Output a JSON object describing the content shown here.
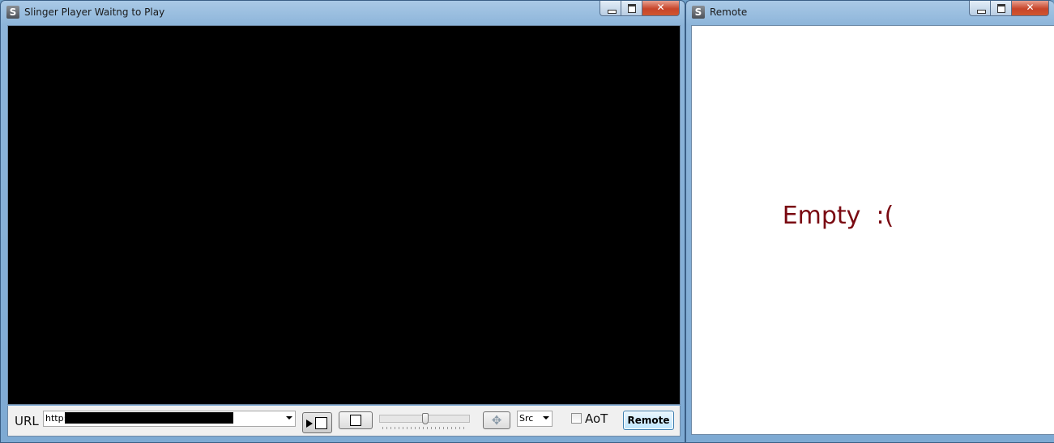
{
  "player": {
    "app_icon": "S",
    "title": "Slinger Player Waitng to Play",
    "url_label": "URL",
    "url_value": "http:",
    "src_value": "Src",
    "aot_label": "AoT",
    "aot_checked": false,
    "remote_button": "Remote"
  },
  "remote": {
    "app_icon": "S",
    "title": "Remote",
    "empty_message": "Empty  :("
  },
  "icons": {
    "play_stop": "play-stop-icon",
    "stop": "stop-icon",
    "move": "move-arrows-icon"
  },
  "colors": {
    "empty_text": "#7a0a12",
    "title_bar": "#8db5da",
    "close_button": "#c7452a"
  }
}
